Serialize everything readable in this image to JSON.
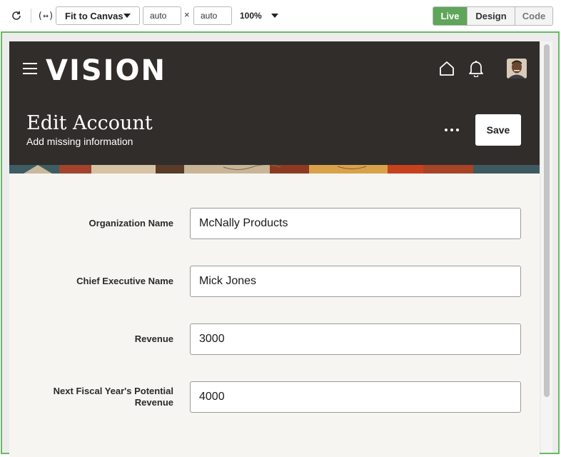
{
  "toolbar": {
    "fit_mode": "Fit to Canvas",
    "width_value": "auto",
    "height_value": "auto",
    "size_separator": "×",
    "zoom": "100%",
    "fit_icon_text": "(↔)",
    "modes": [
      "Live",
      "Design",
      "Code"
    ],
    "active_mode": "Live",
    "accent_color": "#5fa55a"
  },
  "app": {
    "brand": "VISION",
    "header_color": "#312d2a",
    "page_title": "Edit Account",
    "page_subtitle": "Add missing information",
    "save_label": "Save",
    "icons": [
      "hamburger-menu-icon",
      "home-icon",
      "bell-icon",
      "user-avatar",
      "more-options-icon"
    ]
  },
  "form": {
    "fields": [
      {
        "label": "Organization Name",
        "value": "McNally Products"
      },
      {
        "label": "Chief Executive Name",
        "value": "Mick Jones"
      },
      {
        "label": "Revenue",
        "value": "3000"
      },
      {
        "label": "Next Fiscal Year's Potential Revenue",
        "value": "4000"
      }
    ]
  }
}
